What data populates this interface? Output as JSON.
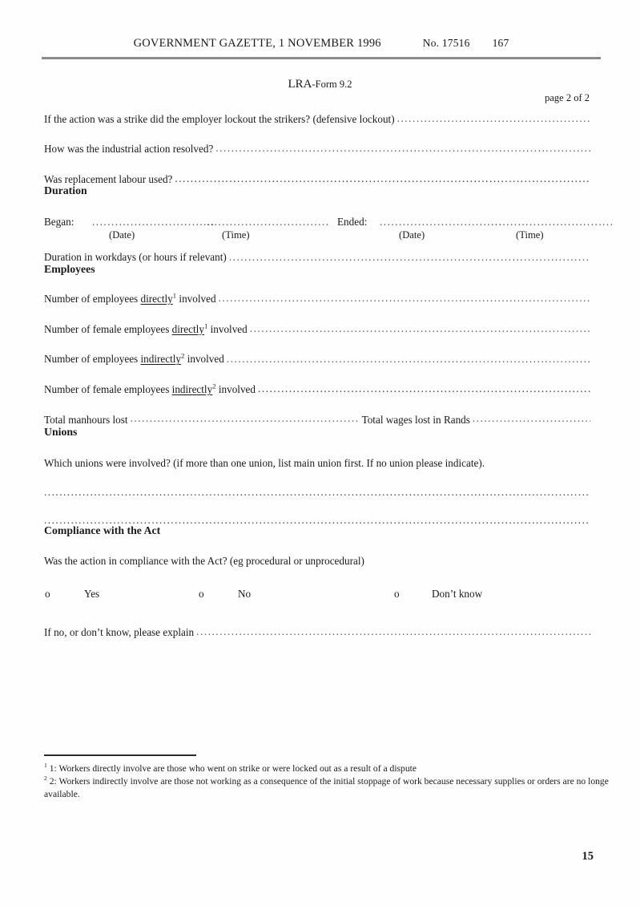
{
  "header": {
    "gazette": "GOVERNMENT GAZETTE, 1 NOVEMBER 1996",
    "number_label": "No. 17516",
    "page_number": "167"
  },
  "form": {
    "title_main": "LRA",
    "title_sub": "-Form 9.2",
    "page_of": "page 2 of 2"
  },
  "questions": {
    "lockout": "If the action was a strike did the employer lockout the strikers?  (defensive lockout)",
    "resolved": "How was the industrial action resolved?",
    "replacement_labour": "Was replacement labour used?"
  },
  "duration": {
    "heading": "Duration",
    "began_label": "Began:",
    "ended_label": "Ended:",
    "blank": "................................",
    "date_caption": "(Date)",
    "time_caption": "(Time)",
    "workdays_label": "Duration in workdays (or hours if relevant)"
  },
  "employees": {
    "heading": "Employees",
    "rows": [
      {
        "pre": "Number of employees ",
        "emph": "directly",
        "note": "1",
        "post": " involved"
      },
      {
        "pre": "Number of female employees ",
        "emph": "directly",
        "note": "1",
        "post": " involved"
      },
      {
        "pre": "Number of employees ",
        "emph": "indirectly",
        "note": "2",
        "post": " involved"
      },
      {
        "pre": "Number of female employees ",
        "emph": "indirectly",
        "note": "2",
        "post": " involved"
      }
    ],
    "manhours_label": "Total manhours lost",
    "wages_label": "Total wages lost in Rands"
  },
  "unions": {
    "heading": "Unions",
    "question": "Which unions were involved? (if more than one union, list main union first.  If no union please indicate)."
  },
  "compliance": {
    "heading": "Compliance with the Act",
    "question": "Was the action in compliance with the Act?  (eg procedural or unprocedural)",
    "marker": "o",
    "options": [
      "Yes",
      "No",
      "Don’t know"
    ],
    "explain_label": "If no, or don’t know, please explain"
  },
  "footnotes": {
    "one_marker": "1",
    "one_text": "1: Workers directly involve are those who went on strike or were locked out as a result of a dispute",
    "two_marker": "2",
    "two_text": "2:  Workers indirectly involve are those not working as a consequence of the initial stoppage of work because necessary supplies or orders are no longe available."
  },
  "folio": "15"
}
